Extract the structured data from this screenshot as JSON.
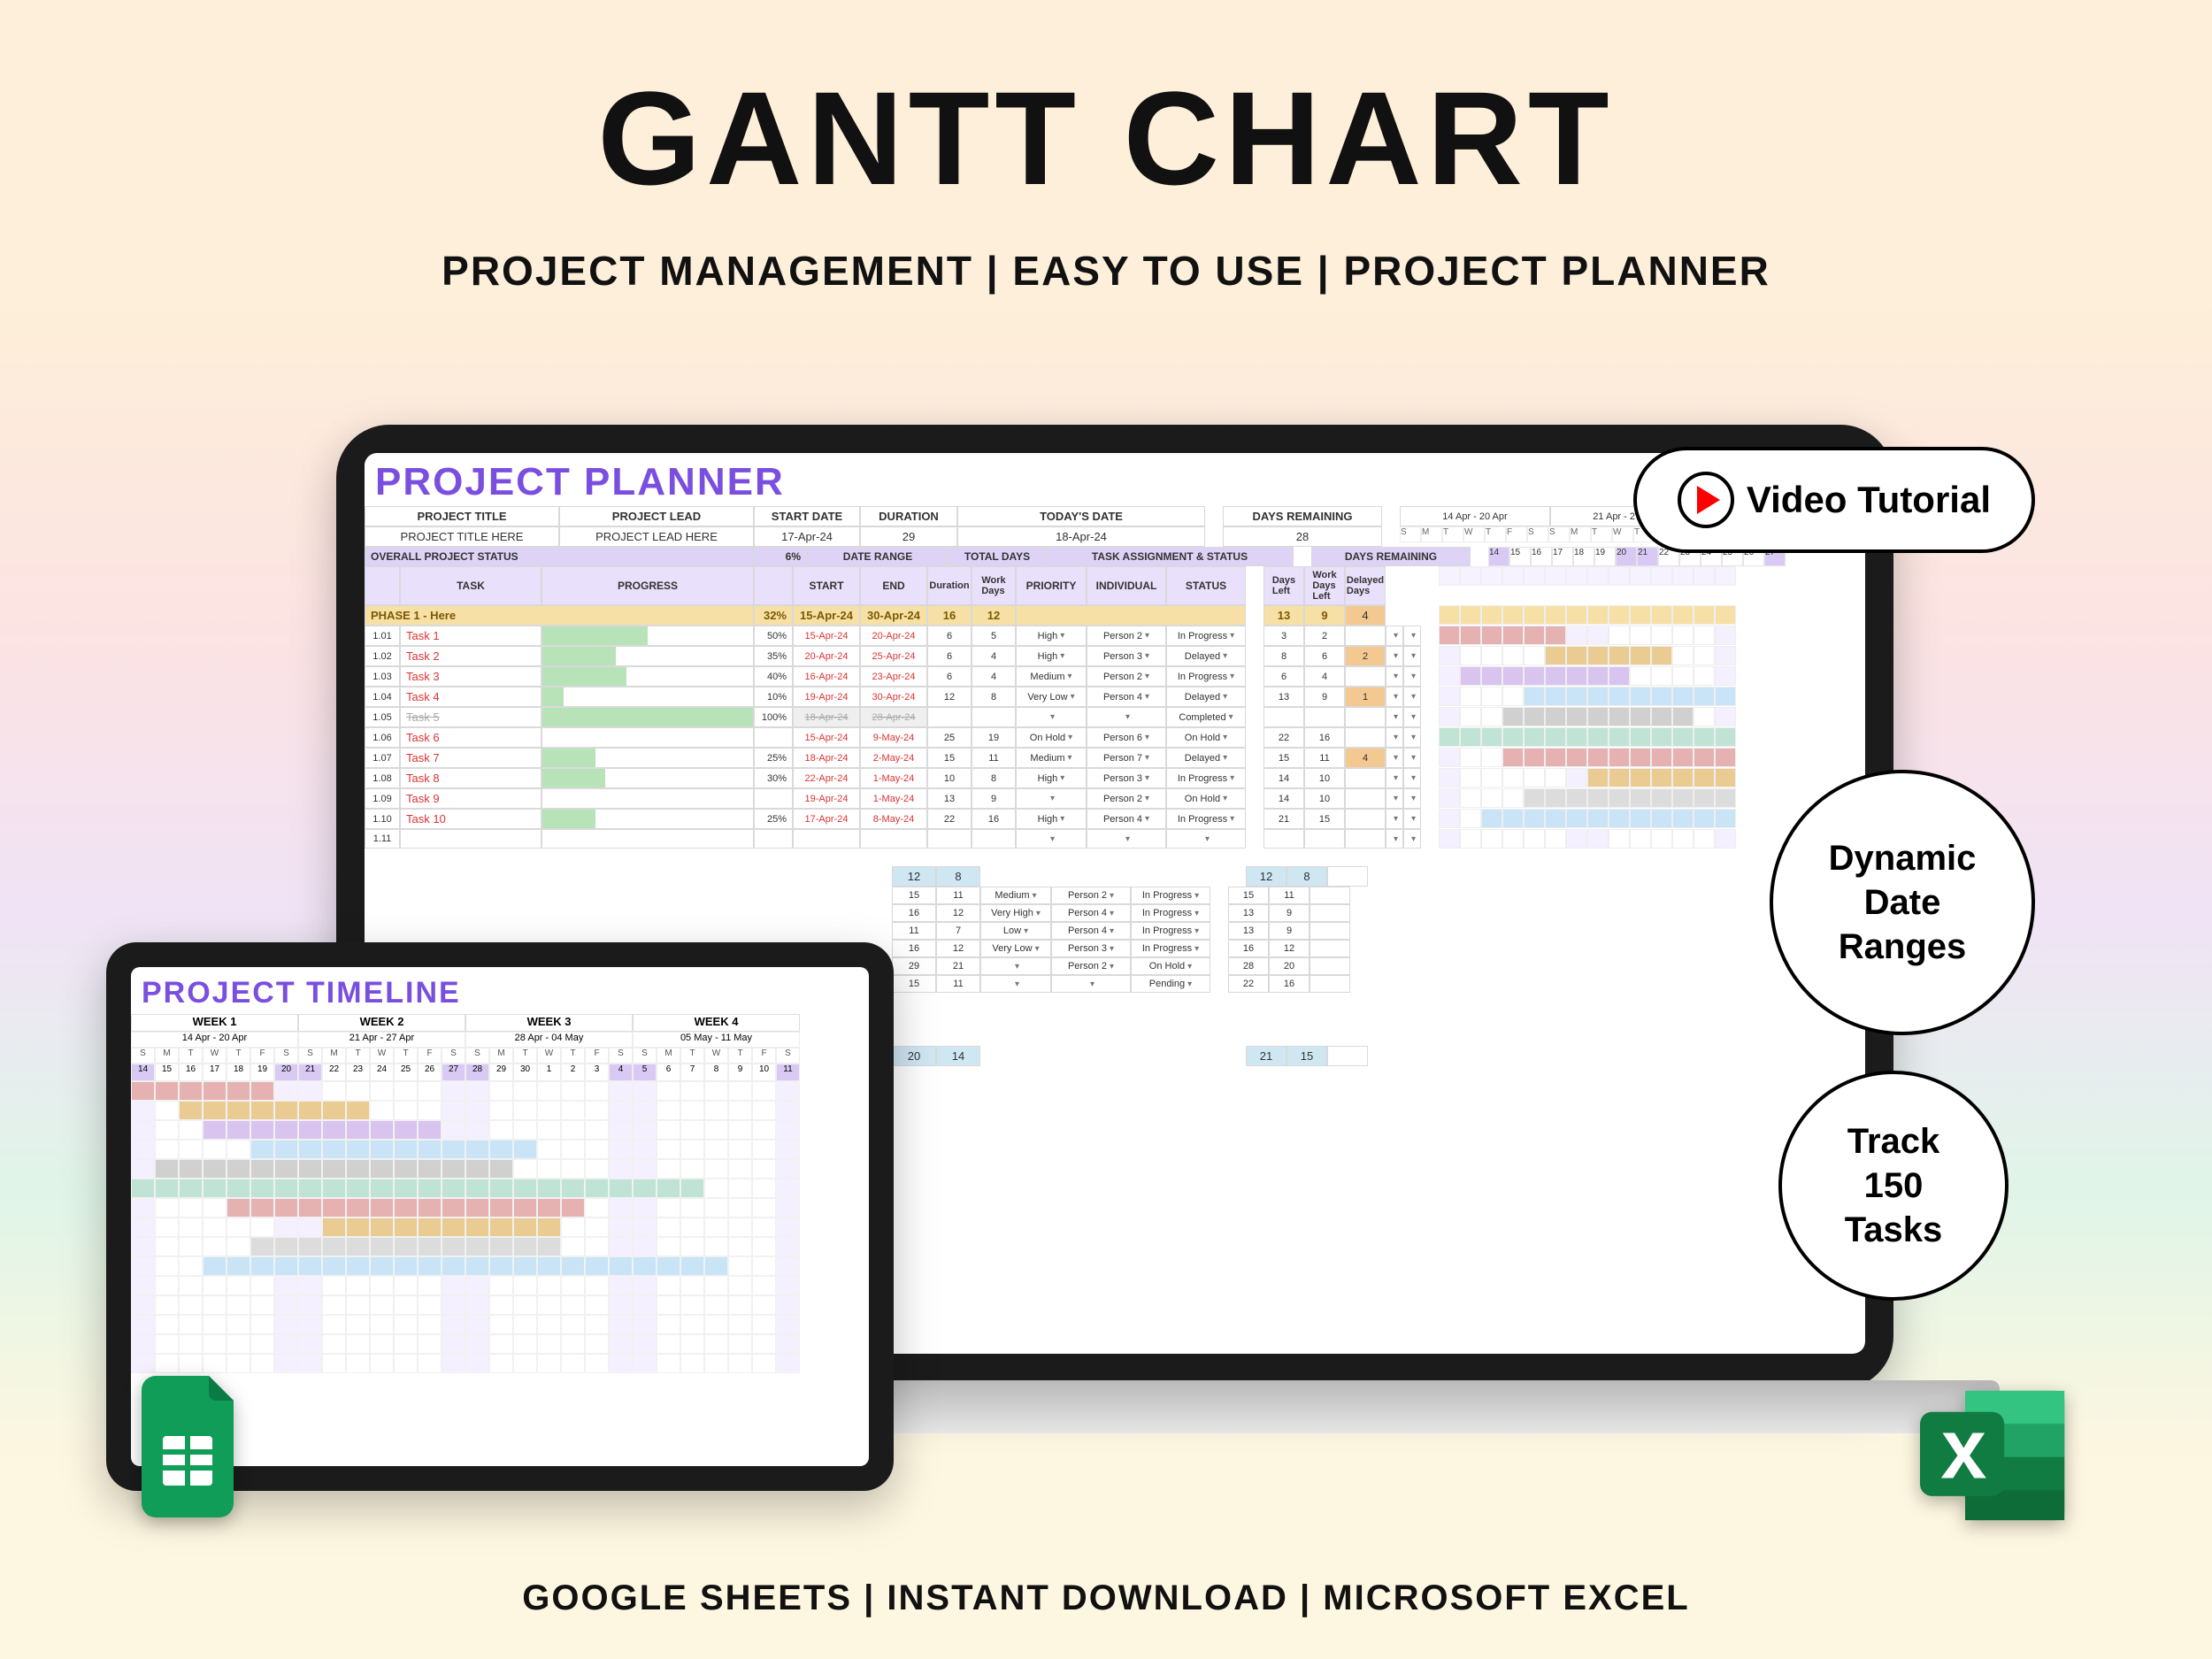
{
  "title": "GANTT CHART",
  "subtitle": "PROJECT MANAGEMENT  |  EASY TO USE  |  PROJECT PLANNER",
  "footer": "GOOGLE SHEETS  |  INSTANT DOWNLOAD  |  MICROSOFT EXCEL",
  "callouts": {
    "video": "Video Tutorial",
    "dynamic": "Dynamic\nDate\nRanges",
    "tasks": "Track\n150\nTasks"
  },
  "planner": {
    "heading": "PROJECT PLANNER",
    "header_labels": {
      "project_title": "PROJECT TITLE",
      "project_lead": "PROJECT LEAD",
      "start_date": "START DATE",
      "duration": "DURATION",
      "todays_date": "TODAY'S DATE",
      "days_remaining": "DAYS REMAINING",
      "overall_status": "OVERALL PROJECT STATUS",
      "date_range": "DATE RANGE",
      "total_days": "TOTAL DAYS",
      "assignment": "TASK ASSIGNMENT & STATUS"
    },
    "header_values": {
      "project_title": "PROJECT TITLE HERE",
      "project_lead": "PROJECT LEAD HERE",
      "start_date": "17-Apr-24",
      "duration": "29",
      "todays_date": "18-Apr-24",
      "days_remaining": "28",
      "overall_pct": "6%"
    },
    "col_labels": {
      "task": "TASK",
      "progress": "PROGRESS",
      "start": "START",
      "end": "END",
      "duration": "Duration",
      "workdays": "Work\nDays",
      "priority": "PRIORITY",
      "individual": "INDIVIDUAL",
      "status": "STATUS",
      "days_left": "Days\nLeft",
      "work_days_left": "Work\nDays\nLeft",
      "delayed": "Delayed\nDays"
    },
    "phase_label": "PHASE 1 - Here",
    "phase_pct": "32%",
    "phase_dates": {
      "start": "15-Apr-24",
      "end": "30-Apr-24"
    },
    "phase_totals": {
      "duration": "16",
      "workdays": "12"
    },
    "phase_days_remaining": {
      "left": "13",
      "work": "9",
      "delayed": "4"
    },
    "rows": [
      {
        "idx": "1.01",
        "task": "Task 1",
        "pct": 50,
        "start": "15-Apr-24",
        "end": "20-Apr-24",
        "dur": "6",
        "wd": "5",
        "pri": "High",
        "ind": "Person 2",
        "stat": "In Progress",
        "dl": "3",
        "wl": "2",
        "del": "",
        "color": "#e6b1b1",
        "g_from": 1,
        "g_to": 6
      },
      {
        "idx": "1.02",
        "task": "Task 2",
        "pct": 35,
        "start": "20-Apr-24",
        "end": "25-Apr-24",
        "dur": "6",
        "wd": "4",
        "pri": "High",
        "ind": "Person 3",
        "stat": "Delayed",
        "dl": "8",
        "wl": "6",
        "del": "2",
        "color": "#eacb92",
        "g_from": 6,
        "g_to": 11
      },
      {
        "idx": "1.03",
        "task": "Task 3",
        "pct": 40,
        "start": "16-Apr-24",
        "end": "23-Apr-24",
        "dur": "6",
        "wd": "4",
        "pri": "Medium",
        "ind": "Person 2",
        "stat": "In Progress",
        "dl": "6",
        "wl": "4",
        "del": "",
        "color": "#d9c3ef",
        "g_from": 2,
        "g_to": 9
      },
      {
        "idx": "1.04",
        "task": "Task 4",
        "pct": 10,
        "start": "19-Apr-24",
        "end": "30-Apr-24",
        "dur": "12",
        "wd": "8",
        "pri": "Very Low",
        "ind": "Person 4",
        "stat": "Delayed",
        "dl": "13",
        "wl": "9",
        "del": "1",
        "color": "#c9e4f6",
        "g_from": 5,
        "g_to": 14
      },
      {
        "idx": "1.05",
        "task": "Task 5",
        "pct": 100,
        "start": "18-Apr-24",
        "end": "28-Apr-24",
        "dur": "",
        "wd": "",
        "pri": "",
        "ind": "",
        "stat": "Completed",
        "dl": "",
        "wl": "",
        "del": "",
        "color": "#d0d0d0",
        "g_from": 4,
        "g_to": 12,
        "struck": true
      },
      {
        "idx": "1.06",
        "task": "Task 6",
        "pct": 0,
        "start": "15-Apr-24",
        "end": "9-May-24",
        "dur": "25",
        "wd": "19",
        "pri": "On Hold",
        "ind": "Person 6",
        "stat": "On Hold",
        "dl": "22",
        "wl": "16",
        "del": "",
        "color": "#bfe3d4",
        "g_from": 1,
        "g_to": 14
      },
      {
        "idx": "1.07",
        "task": "Task 7",
        "pct": 25,
        "start": "18-Apr-24",
        "end": "2-May-24",
        "dur": "15",
        "wd": "11",
        "pri": "Medium",
        "ind": "Person 7",
        "stat": "Delayed",
        "dl": "15",
        "wl": "11",
        "del": "4",
        "color": "#e6b1b1",
        "g_from": 4,
        "g_to": 14
      },
      {
        "idx": "1.08",
        "task": "Task 8",
        "pct": 30,
        "start": "22-Apr-24",
        "end": "1-May-24",
        "dur": "10",
        "wd": "8",
        "pri": "High",
        "ind": "Person 3",
        "stat": "In Progress",
        "dl": "14",
        "wl": "10",
        "del": "",
        "color": "#eacb92",
        "g_from": 8,
        "g_to": 14
      },
      {
        "idx": "1.09",
        "task": "Task 9",
        "pct": 0,
        "start": "19-Apr-24",
        "end": "1-May-24",
        "dur": "13",
        "wd": "9",
        "pri": "",
        "ind": "Person 2",
        "stat": "On Hold",
        "dl": "14",
        "wl": "10",
        "del": "",
        "color": "#dcdcdc",
        "g_from": 5,
        "g_to": 14
      },
      {
        "idx": "1.10",
        "task": "Task 10",
        "pct": 25,
        "start": "17-Apr-24",
        "end": "8-May-24",
        "dur": "22",
        "wd": "16",
        "pri": "High",
        "ind": "Person 4",
        "stat": "In Progress",
        "dl": "21",
        "wl": "15",
        "del": "",
        "color": "#c9e4f6",
        "g_from": 3,
        "g_to": 14
      },
      {
        "idx": "1.11",
        "task": "",
        "pct": 0,
        "start": "",
        "end": "",
        "dur": "",
        "wd": "",
        "pri": "",
        "ind": "",
        "stat": "",
        "dl": "",
        "wl": "",
        "del": "",
        "color": "",
        "g_from": 0,
        "g_to": 0
      }
    ],
    "extra_block": {
      "summary": {
        "a": "12",
        "b": "8",
        "a2": "12",
        "b2": "8"
      },
      "rows": [
        {
          "dur": "15",
          "wd": "11",
          "pri": "Medium",
          "ind": "Person 2",
          "stat": "In Progress",
          "dl": "15",
          "wl": "11"
        },
        {
          "dur": "16",
          "wd": "12",
          "pri": "Very High",
          "ind": "Person 4",
          "stat": "In Progress",
          "dl": "13",
          "wl": "9"
        },
        {
          "dur": "11",
          "wd": "7",
          "pri": "Low",
          "ind": "Person 4",
          "stat": "In Progress",
          "dl": "13",
          "wl": "9"
        },
        {
          "dur": "16",
          "wd": "12",
          "pri": "Very Low",
          "ind": "Person 3",
          "stat": "In Progress",
          "dl": "16",
          "wl": "12"
        },
        {
          "dur": "29",
          "wd": "21",
          "pri": "",
          "ind": "Person 2",
          "stat": "On Hold",
          "dl": "28",
          "wl": "20"
        },
        {
          "dur": "15",
          "wd": "11",
          "pri": "",
          "ind": "",
          "stat": "Pending",
          "dl": "22",
          "wl": "16"
        }
      ],
      "footer": {
        "a": "20",
        "b": "14",
        "a2": "21",
        "b2": "15"
      }
    },
    "week_ranges": [
      "14 Apr - 20 Apr",
      "21 Apr - 27 Apr"
    ],
    "dows": [
      "S",
      "M",
      "T",
      "W",
      "T",
      "F",
      "S",
      "S",
      "M",
      "T",
      "W",
      "T",
      "F",
      "S"
    ],
    "days": [
      "14",
      "15",
      "16",
      "17",
      "18",
      "19",
      "20",
      "21",
      "22",
      "23",
      "24",
      "25",
      "26",
      "27"
    ]
  },
  "timeline": {
    "heading": "PROJECT TIMELINE",
    "weeks": [
      {
        "label": "WEEK 1",
        "range": "14 Apr - 20 Apr"
      },
      {
        "label": "WEEK 2",
        "range": "21 Apr - 27 Apr"
      },
      {
        "label": "WEEK 3",
        "range": "28 Apr - 04 May"
      },
      {
        "label": "WEEK 4",
        "range": "05 May - 11 May"
      }
    ],
    "dows": [
      "S",
      "M",
      "T",
      "W",
      "T",
      "F",
      "S",
      "S",
      "M",
      "T",
      "W",
      "T",
      "F",
      "S",
      "S",
      "M",
      "T",
      "W",
      "T",
      "F",
      "S",
      "S",
      "M",
      "T",
      "W",
      "T",
      "F",
      "S"
    ],
    "days": [
      "14",
      "15",
      "16",
      "17",
      "18",
      "19",
      "20",
      "21",
      "22",
      "23",
      "24",
      "25",
      "26",
      "27",
      "28",
      "29",
      "30",
      "1",
      "2",
      "3",
      "4",
      "5",
      "6",
      "7",
      "8",
      "9",
      "10",
      "11"
    ],
    "bars": [
      {
        "from": 1,
        "to": 6,
        "color": "#e6b1b1"
      },
      {
        "from": 3,
        "to": 10,
        "color": "#eacb92"
      },
      {
        "from": 4,
        "to": 13,
        "color": "#d9c3ef"
      },
      {
        "from": 6,
        "to": 17,
        "color": "#c9e4f6"
      },
      {
        "from": 2,
        "to": 16,
        "color": "#d0d0d0"
      },
      {
        "from": 1,
        "to": 24,
        "color": "#bfe3d4"
      },
      {
        "from": 5,
        "to": 19,
        "color": "#e6b1b1"
      },
      {
        "from": 9,
        "to": 18,
        "color": "#eacb92"
      },
      {
        "from": 6,
        "to": 18,
        "color": "#dcdcdc"
      },
      {
        "from": 4,
        "to": 25,
        "color": "#c9e4f6"
      }
    ]
  },
  "chart_data": [
    {
      "type": "gantt",
      "title": "PROJECT PLANNER — Phase 1",
      "x_unit": "date",
      "x_range": [
        "2024-04-14",
        "2024-05-09"
      ],
      "tasks": [
        {
          "id": "1.01",
          "name": "Task 1",
          "start": "2024-04-15",
          "end": "2024-04-20",
          "pct": 50,
          "priority": "High",
          "assignee": "Person 2",
          "status": "In Progress"
        },
        {
          "id": "1.02",
          "name": "Task 2",
          "start": "2024-04-20",
          "end": "2024-04-25",
          "pct": 35,
          "priority": "High",
          "assignee": "Person 3",
          "status": "Delayed"
        },
        {
          "id": "1.03",
          "name": "Task 3",
          "start": "2024-04-16",
          "end": "2024-04-23",
          "pct": 40,
          "priority": "Medium",
          "assignee": "Person 2",
          "status": "In Progress"
        },
        {
          "id": "1.04",
          "name": "Task 4",
          "start": "2024-04-19",
          "end": "2024-04-30",
          "pct": 10,
          "priority": "Very Low",
          "assignee": "Person 4",
          "status": "Delayed"
        },
        {
          "id": "1.05",
          "name": "Task 5",
          "start": "2024-04-18",
          "end": "2024-04-28",
          "pct": 100,
          "priority": "",
          "assignee": "",
          "status": "Completed"
        },
        {
          "id": "1.06",
          "name": "Task 6",
          "start": "2024-04-15",
          "end": "2024-05-09",
          "pct": 0,
          "priority": "On Hold",
          "assignee": "Person 6",
          "status": "On Hold"
        },
        {
          "id": "1.07",
          "name": "Task 7",
          "start": "2024-04-18",
          "end": "2024-05-02",
          "pct": 25,
          "priority": "Medium",
          "assignee": "Person 7",
          "status": "Delayed"
        },
        {
          "id": "1.08",
          "name": "Task 8",
          "start": "2024-04-22",
          "end": "2024-05-01",
          "pct": 30,
          "priority": "High",
          "assignee": "Person 3",
          "status": "In Progress"
        },
        {
          "id": "1.09",
          "name": "Task 9",
          "start": "2024-04-19",
          "end": "2024-05-01",
          "pct": 0,
          "priority": "",
          "assignee": "Person 2",
          "status": "On Hold"
        },
        {
          "id": "1.10",
          "name": "Task 10",
          "start": "2024-04-17",
          "end": "2024-05-08",
          "pct": 25,
          "priority": "High",
          "assignee": "Person 4",
          "status": "In Progress"
        }
      ],
      "summary": {
        "overall_pct": 6,
        "phase_pct": 32,
        "start": "2024-04-17",
        "today": "2024-04-18",
        "duration_days": 29,
        "days_remaining": 28
      }
    },
    {
      "type": "gantt",
      "title": "PROJECT TIMELINE",
      "x_unit": "date",
      "x_range": [
        "2024-04-14",
        "2024-05-11"
      ],
      "tasks": [
        {
          "name": "Task 1",
          "start": "2024-04-15",
          "end": "2024-04-20"
        },
        {
          "name": "Task 2",
          "start": "2024-04-17",
          "end": "2024-04-24"
        },
        {
          "name": "Task 3",
          "start": "2024-04-18",
          "end": "2024-04-27"
        },
        {
          "name": "Task 4",
          "start": "2024-04-20",
          "end": "2024-05-01"
        },
        {
          "name": "Task 5",
          "start": "2024-04-16",
          "end": "2024-04-30"
        },
        {
          "name": "Task 6",
          "start": "2024-04-15",
          "end": "2024-05-08"
        },
        {
          "name": "Task 7",
          "start": "2024-04-19",
          "end": "2024-05-03"
        },
        {
          "name": "Task 8",
          "start": "2024-04-23",
          "end": "2024-05-02"
        },
        {
          "name": "Task 9",
          "start": "2024-04-20",
          "end": "2024-05-02"
        },
        {
          "name": "Task 10",
          "start": "2024-04-18",
          "end": "2024-05-09"
        }
      ]
    }
  ]
}
